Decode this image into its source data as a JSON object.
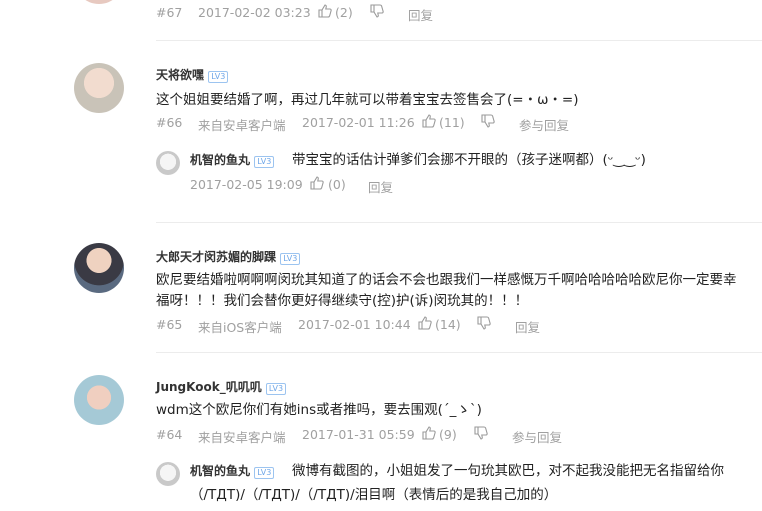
{
  "comments": [
    {
      "floor": "#67",
      "time": "2017-02-02 03:23",
      "likes": "(2)",
      "reply": "回复"
    },
    {
      "user": "天将欲嘿",
      "level": "LV3",
      "text": "这个姐姐要结婚了啊，再过几年就可以带着宝宝去签售会了(=・ω・=)",
      "floor": "#66",
      "source": "来自安卓客户端",
      "time": "2017-02-01 11:26",
      "likes": "(11)",
      "reply": "参与回复",
      "sub_reply": {
        "user": "机智的鱼丸",
        "level": "LV3",
        "text": "带宝宝的话估计弹爹们会挪不开眼的（孩子迷啊都）(ᵕ‿‿ᵕ)",
        "time": "2017-02-05 19:09",
        "likes": "(0)",
        "reply": "回复"
      }
    },
    {
      "user": "大郎天才闵苏媚的脚踝",
      "level": "LV3",
      "text_line1": "欧尼要结婚啦啊啊啊闵玧其知道了的话会不会也跟我们一样感慨万千啊哈哈哈哈哈欧尼你一定要幸",
      "text_line2": "福呀！！！我们会替你更好得继续守(控)护(诉)闵玧其的！！！",
      "floor": "#65",
      "source": "来自iOS客户端",
      "time": "2017-02-01 10:44",
      "likes": "(14)",
      "reply": "回复"
    },
    {
      "user": "JungKook_叽叽叽",
      "level": "LV3",
      "text": "wdm这个欧尼你们有她ins或者推吗，要去围观(´_ゝ`)",
      "floor": "#64",
      "source": "来自安卓客户端",
      "time": "2017-01-31 05:59",
      "likes": "(9)",
      "reply": "参与回复",
      "sub_reply": {
        "user": "机智的鱼丸",
        "level": "LV3",
        "text_line1": "微博有截图的，小姐姐发了一句玧其欧巴，对不起我没能把无名指留给你",
        "text_line2": "（/TДT)/（/TДT)/（/TДT)/泪目啊（表情后的是我自己加的）"
      }
    }
  ],
  "icons": [
    "thumbs-up-icon",
    "thumbs-down-icon"
  ]
}
